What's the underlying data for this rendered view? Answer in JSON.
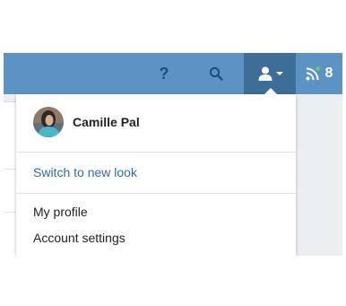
{
  "navbar": {
    "help_label": "?",
    "search_icon": "search-icon",
    "profile_icon": "user-icon",
    "feed_icon": "rss-icon",
    "feed_count": "8",
    "colors": {
      "bar": "#5b93c4",
      "active": "#3c6e98",
      "dark_icon": "#1f4f78",
      "status_dot": "#5fd35a"
    }
  },
  "dropdown": {
    "user_name": "Camille Pal",
    "switch_link": "Switch to new look",
    "items": [
      {
        "label": "My profile"
      },
      {
        "label": "Account settings"
      }
    ],
    "colors": {
      "link": "#2f6ea8"
    }
  }
}
